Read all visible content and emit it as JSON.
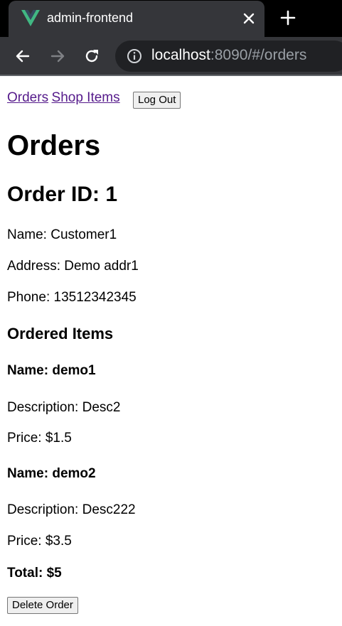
{
  "browser": {
    "tab_title": "admin-frontend",
    "url_host": "localhost",
    "url_rest": ":8090/#/orders",
    "icons": {
      "favicon": "vue-logo-icon",
      "close": "close-icon",
      "new_tab": "plus-icon",
      "back": "back-arrow-icon",
      "forward": "forward-arrow-icon",
      "reload": "reload-icon",
      "site_info": "info-icon"
    },
    "colors": {
      "tabstrip": "#000000",
      "toolbar": "#35363a",
      "omnibox": "#202124",
      "vue_green": "#41b883"
    }
  },
  "nav": {
    "orders_link": "Orders",
    "shop_items_link": "Shop Items",
    "logout_button": "Log Out",
    "link_color": "#551a8b"
  },
  "page": {
    "title": "Orders"
  },
  "order": {
    "heading": "Order ID: 1",
    "name": "Name: Customer1",
    "address": "Address: Demo addr1",
    "phone": "Phone: 13512342345",
    "items_heading": "Ordered Items",
    "items": [
      {
        "name": "Name: demo1",
        "description": "Description: Desc2",
        "price": "Price: $1.5"
      },
      {
        "name": "Name: demo2",
        "description": "Description: Desc222",
        "price": "Price: $3.5"
      }
    ],
    "total": "Total: $5",
    "delete_button": "Delete Order"
  }
}
